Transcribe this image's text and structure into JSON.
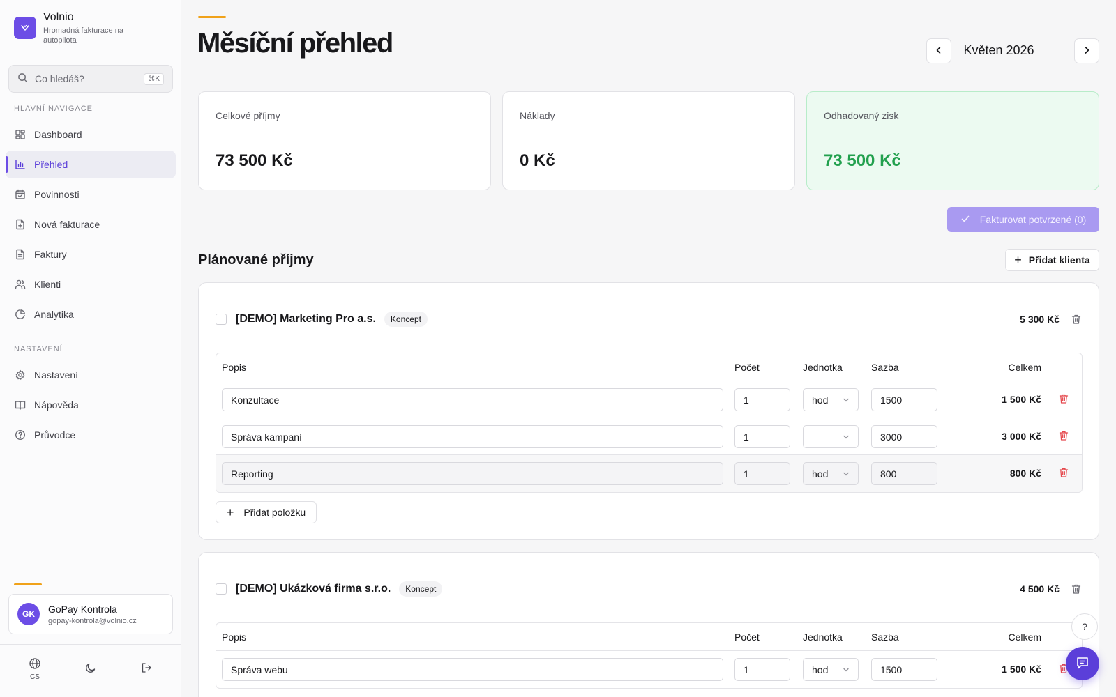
{
  "brand": {
    "name": "Volnio",
    "tagline": "Hromadná fakturace na autopilota"
  },
  "search": {
    "placeholder": "Co hledáš?",
    "shortcut": "⌘K"
  },
  "nav": {
    "main_heading": "HLAVNÍ NAVIGACE",
    "main_items": [
      {
        "label": "Dashboard",
        "icon": "grid-icon"
      },
      {
        "label": "Přehled",
        "icon": "bar-chart-icon",
        "active": true
      },
      {
        "label": "Povinnosti",
        "icon": "calendar-check-icon"
      },
      {
        "label": "Nová fakturace",
        "icon": "file-plus-icon"
      },
      {
        "label": "Faktury",
        "icon": "file-text-icon"
      },
      {
        "label": "Klienti",
        "icon": "users-icon"
      },
      {
        "label": "Analytika",
        "icon": "pie-chart-icon"
      }
    ],
    "settings_heading": "NASTAVENÍ",
    "settings_items": [
      {
        "label": "Nastavení",
        "icon": "gear-icon"
      },
      {
        "label": "Nápověda",
        "icon": "book-icon"
      },
      {
        "label": "Průvodce",
        "icon": "help-circle-icon"
      }
    ]
  },
  "user": {
    "initials": "GK",
    "name": "GoPay Kontrola",
    "email": "gopay-kontrola@volnio.cz"
  },
  "footer": {
    "language": "CS"
  },
  "page": {
    "title": "Měsíční přehled",
    "month": "Květen 2026"
  },
  "stats": [
    {
      "label": "Celkové příjmy",
      "value": "73 500 Kč"
    },
    {
      "label": "Náklady",
      "value": "0 Kč"
    },
    {
      "label": "Odhadovaný zisk",
      "value": "73 500 Kč",
      "color": "#22a04e"
    }
  ],
  "invoice_button": "Fakturovat potvrzené (0)",
  "planned": {
    "title": "Plánované příjmy",
    "add_client": "Přidat klienta"
  },
  "table_headers": {
    "desc": "Popis",
    "qty": "Počet",
    "unit": "Jednotka",
    "rate": "Sazba",
    "total": "Celkem"
  },
  "add_item": "Přidat položku",
  "clients": [
    {
      "name": "[DEMO] Marketing Pro a.s.",
      "status": "Koncept",
      "total": "5 300 Kč",
      "items": [
        {
          "desc": "Konzultace",
          "qty": "1",
          "unit": "hod",
          "rate": "1500",
          "total": "1 500 Kč"
        },
        {
          "desc": "Správa kampaní",
          "qty": "1",
          "unit": "",
          "rate": "3000",
          "total": "3 000 Kč"
        },
        {
          "desc": "Reporting",
          "qty": "1",
          "unit": "hod",
          "rate": "800",
          "total": "800 Kč"
        }
      ]
    },
    {
      "name": "[DEMO] Ukázková firma s.r.o.",
      "status": "Koncept",
      "total": "4 500 Kč",
      "items": [
        {
          "desc": "Správa webu",
          "qty": "1",
          "unit": "hod",
          "rate": "1500",
          "total": "1 500 Kč"
        }
      ]
    }
  ],
  "help": {
    "label": "?"
  },
  "colors": {
    "accent": "#6c4de6",
    "orange": "#f0a21a",
    "danger": "#e5484d",
    "success": "#22a04e"
  }
}
